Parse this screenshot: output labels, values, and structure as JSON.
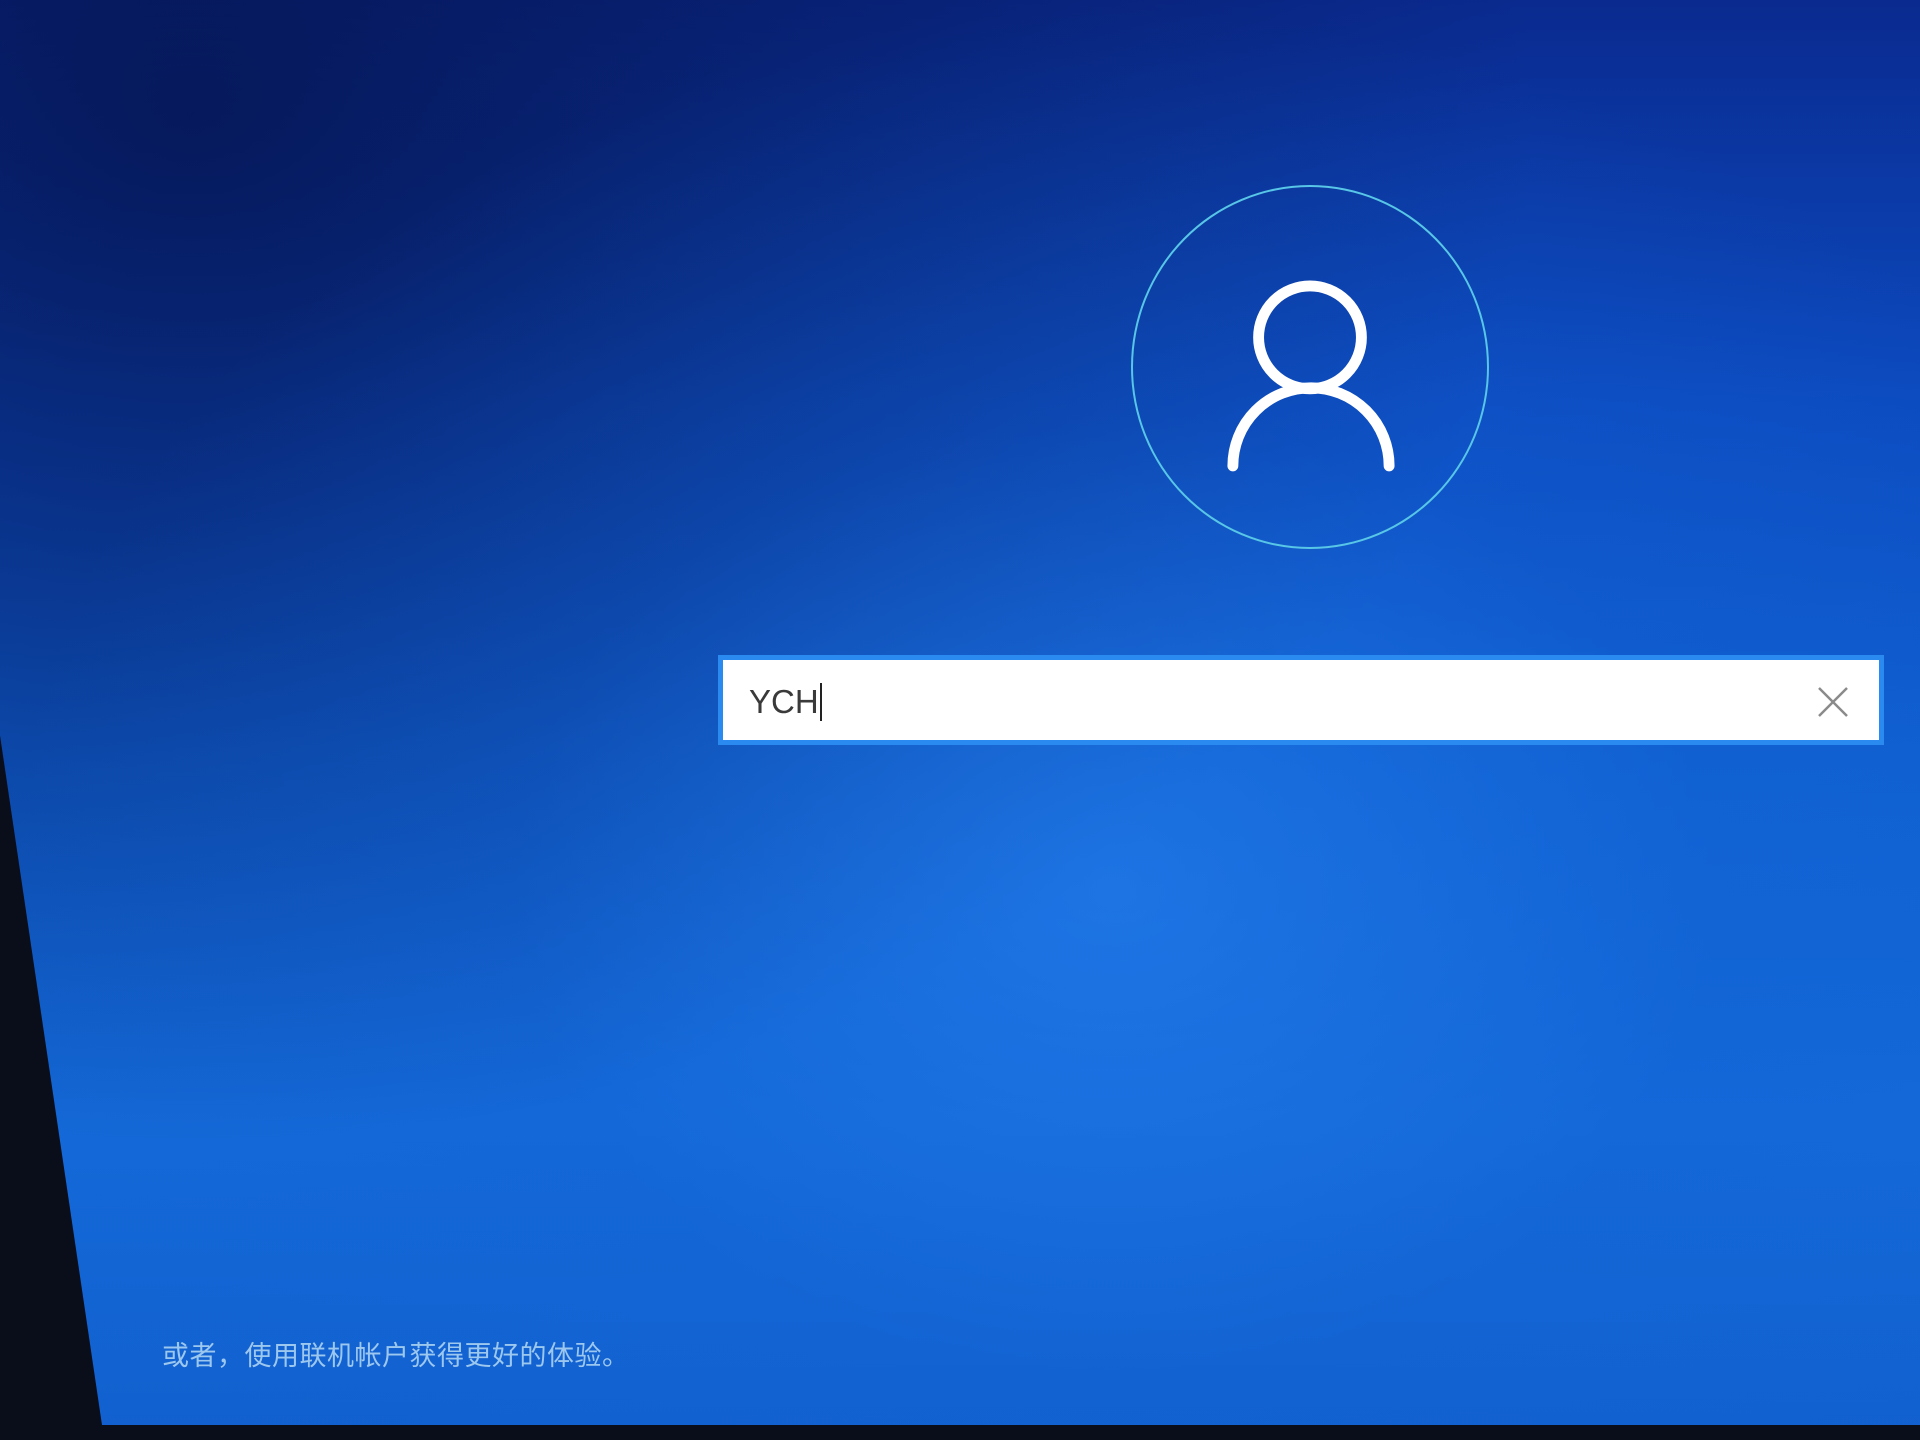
{
  "account_setup": {
    "username_input": {
      "value": "YCH"
    },
    "clear_button_label": "×",
    "online_account_link": "或者，使用联机帐户获得更好的体验。"
  },
  "colors": {
    "background_top": "#0a2a8f",
    "background_mid": "#0f5fd0",
    "avatar_ring": "#58c6e6",
    "input_border": "#2a8af0",
    "link_text": "#9cc7ee"
  },
  "icons": {
    "avatar": "user-icon",
    "clear": "close-icon"
  }
}
